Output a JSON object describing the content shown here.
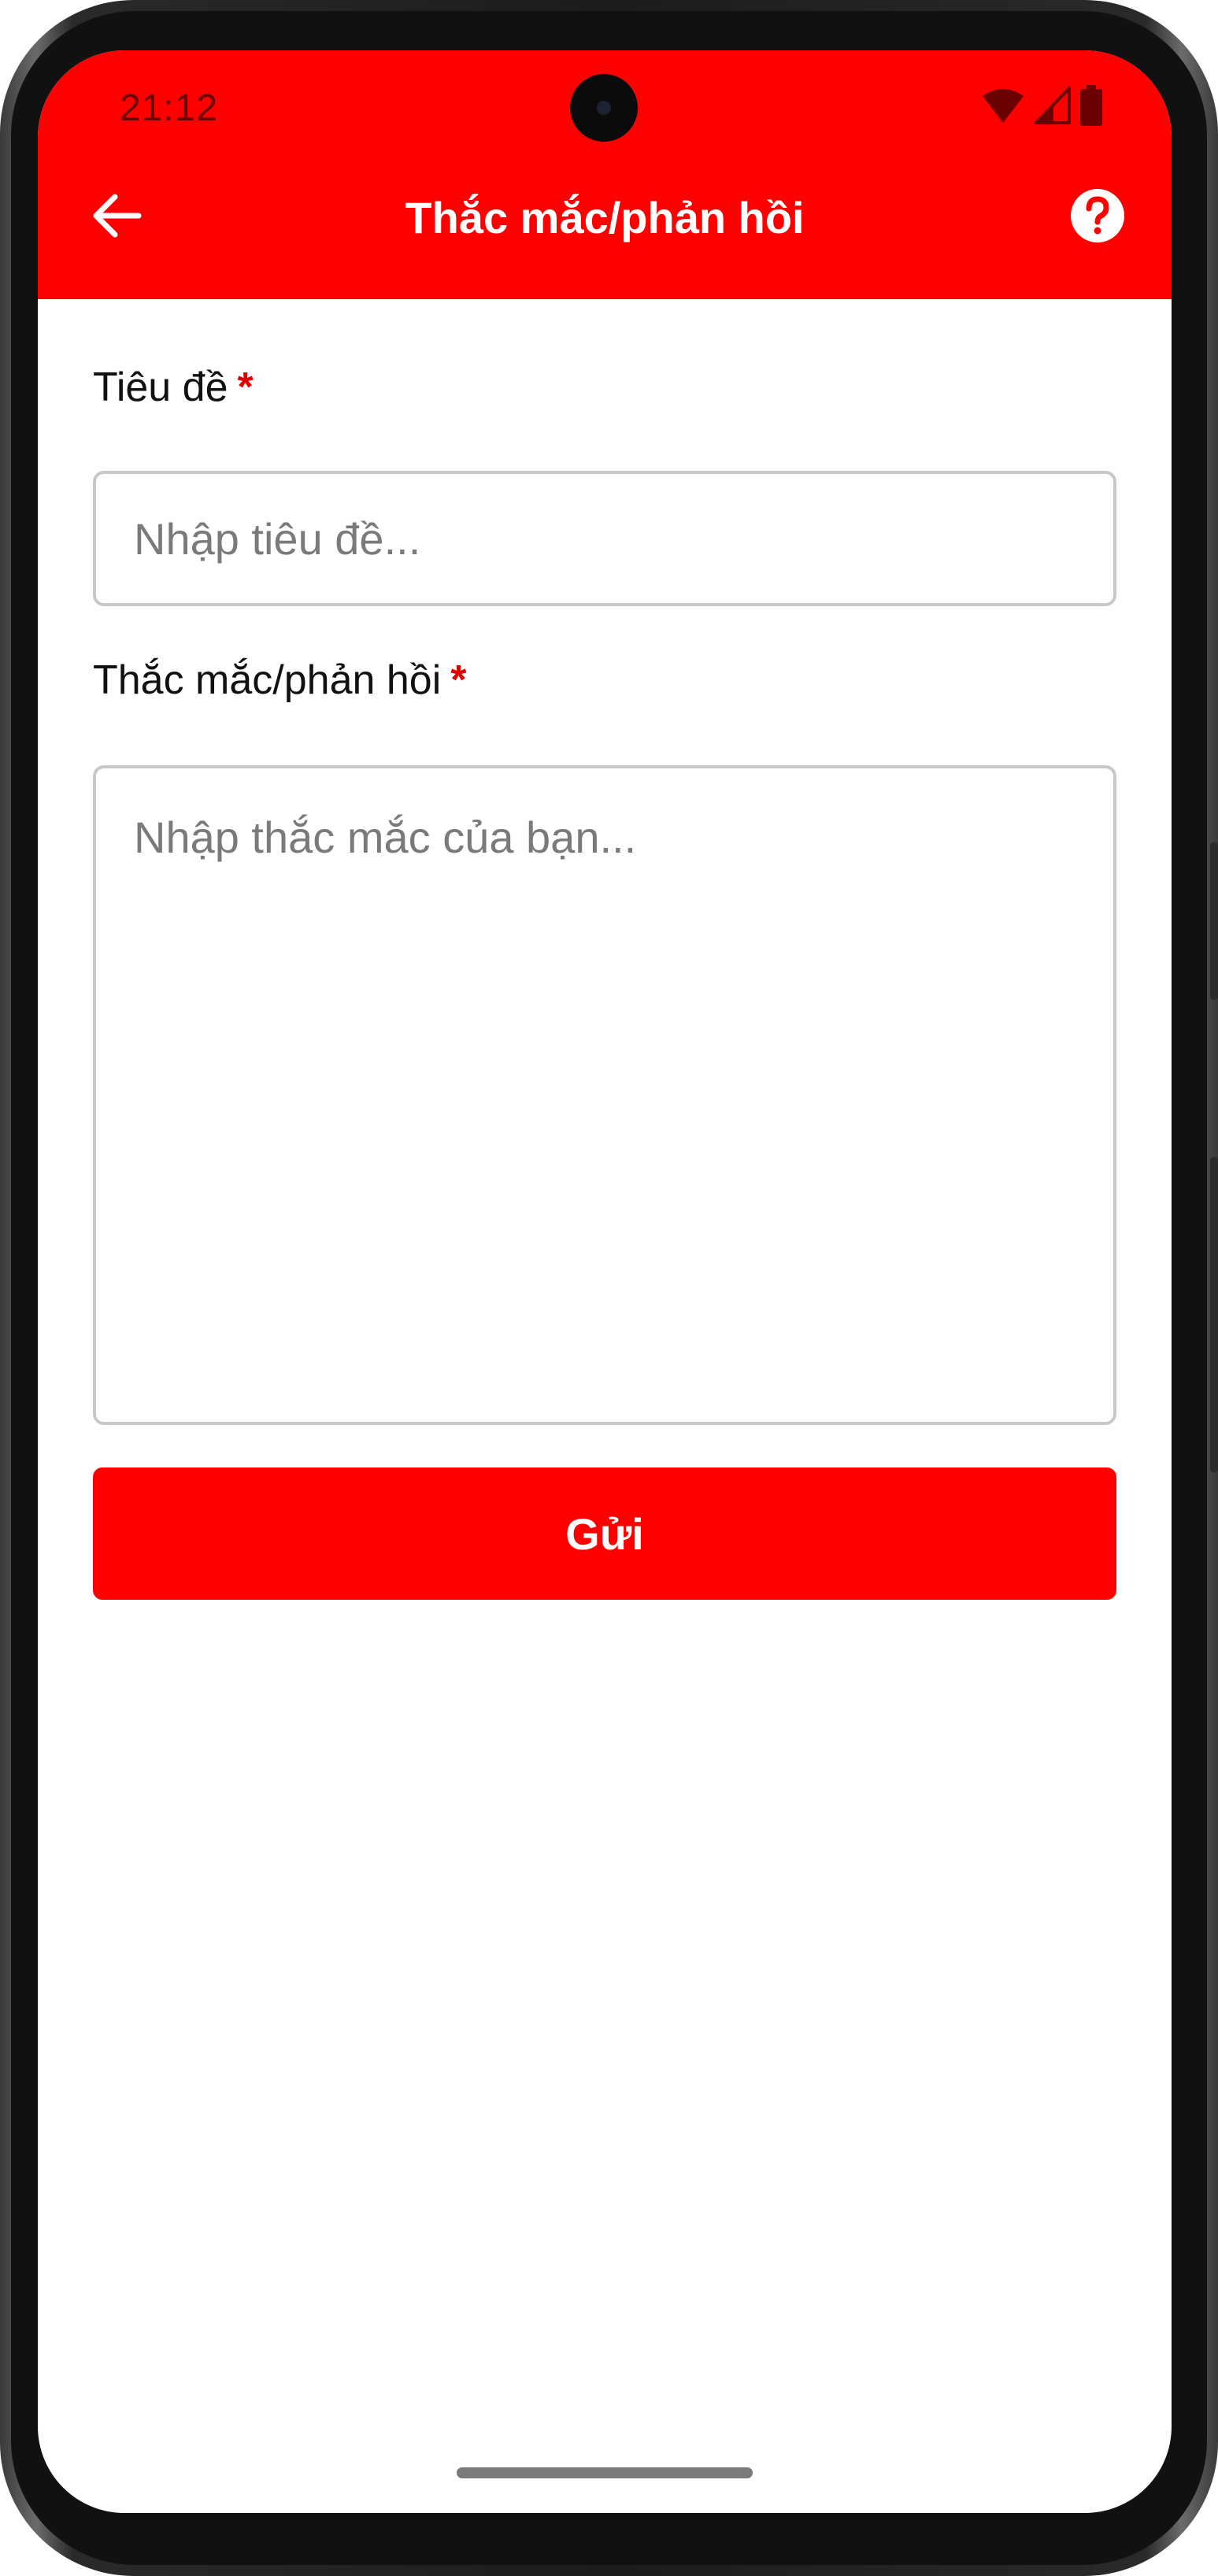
{
  "status_bar": {
    "time": "21:12",
    "icons": [
      "wifi-icon",
      "cellular-signal-icon",
      "battery-icon"
    ]
  },
  "app_bar": {
    "title": "Thắc mắc/phản hồi",
    "back_icon": "arrow-left-icon",
    "help_icon": "help-circle-icon",
    "background_color": "#ff0000"
  },
  "form": {
    "title_field": {
      "label": "Tiêu đề",
      "required_mark": "*",
      "value": "",
      "placeholder": "Nhập tiêu đề..."
    },
    "feedback_field": {
      "label": "Thắc mắc/phản hồi",
      "required_mark": "*",
      "value": "",
      "placeholder": "Nhập thắc mắc của bạn..."
    },
    "submit_label": "Gửi"
  }
}
